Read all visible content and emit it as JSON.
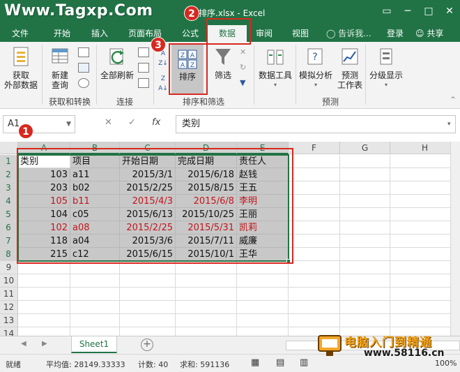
{
  "titlebar": {
    "watermark": "Www.Tagxp.Com",
    "title": "排序.xlsx - Excel",
    "restore_glyph": "▭",
    "minimize_glyph": "─",
    "maximize_glyph": "□",
    "close_glyph": "✕"
  },
  "tabs": [
    "文件",
    "开始",
    "插入",
    "页面布局",
    "公式",
    "数据",
    "审阅",
    "视图"
  ],
  "active_tab": "数据",
  "tell_me": "告诉我...",
  "sign_in": "登录",
  "share": "共享",
  "ribbon": {
    "get_external": "获取\n外部数据",
    "new_query": "新建\n查询",
    "group_get_transform": "获取和转换",
    "refresh_all": "全部刷新",
    "group_connections": "连接",
    "sort": "排序",
    "filter": "筛选",
    "group_sort_filter": "排序和筛选",
    "data_tools": "数据工具",
    "what_if": "模拟分析",
    "forecast_sheet": "预测\n工作表",
    "group_forecast": "预测",
    "outline": "分级显示"
  },
  "formula_bar": {
    "name_box": "A1",
    "formula": "类别",
    "fx": "fx"
  },
  "columns": [
    "A",
    "B",
    "C",
    "D",
    "E",
    "F",
    "G",
    "H"
  ],
  "rows": [
    "1",
    "2",
    "3",
    "4",
    "5",
    "6",
    "7",
    "8",
    "9",
    "10",
    "11",
    "12",
    "13",
    "14"
  ],
  "table": {
    "headers": [
      "类别",
      "项目",
      "开始日期",
      "完成日期",
      "责任人"
    ],
    "data": [
      {
        "cat": "103",
        "item": "a11",
        "start": "2015/3/1",
        "end": "2015/6/18",
        "owner": "赵钱",
        "red": false
      },
      {
        "cat": "203",
        "item": "b02",
        "start": "2015/2/25",
        "end": "2015/8/15",
        "owner": "王五",
        "red": false
      },
      {
        "cat": "105",
        "item": "b11",
        "start": "2015/4/3",
        "end": "2015/6/8",
        "owner": "李明",
        "red": true
      },
      {
        "cat": "104",
        "item": "c05",
        "start": "2015/6/13",
        "end": "2015/10/25",
        "owner": "王丽",
        "red": false
      },
      {
        "cat": "102",
        "item": "a08",
        "start": "2015/2/25",
        "end": "2015/5/31",
        "owner": "凯莉",
        "red": true
      },
      {
        "cat": "118",
        "item": "a04",
        "start": "2015/3/6",
        "end": "2015/7/11",
        "owner": "威廉",
        "red": false
      },
      {
        "cat": "215",
        "item": "c12",
        "start": "2015/6/15",
        "end": "2015/10/1",
        "owner": "王华",
        "red": false
      }
    ]
  },
  "sheet_tab": "Sheet1",
  "status": {
    "ready": "就绪",
    "average": "平均值: 28149.33333",
    "count": "计数: 40",
    "sum": "求和: 591136",
    "zoom": "100%"
  },
  "callouts": [
    "1",
    "2",
    "3"
  ],
  "logo": {
    "cn": "电脑入门到精通",
    "url": "www.58116.cn"
  },
  "colors": {
    "excel_green": "#217346",
    "callout_red": "#d8281e",
    "highlight_text": "#c0161c",
    "selection_fill": "#c8c8c8"
  }
}
